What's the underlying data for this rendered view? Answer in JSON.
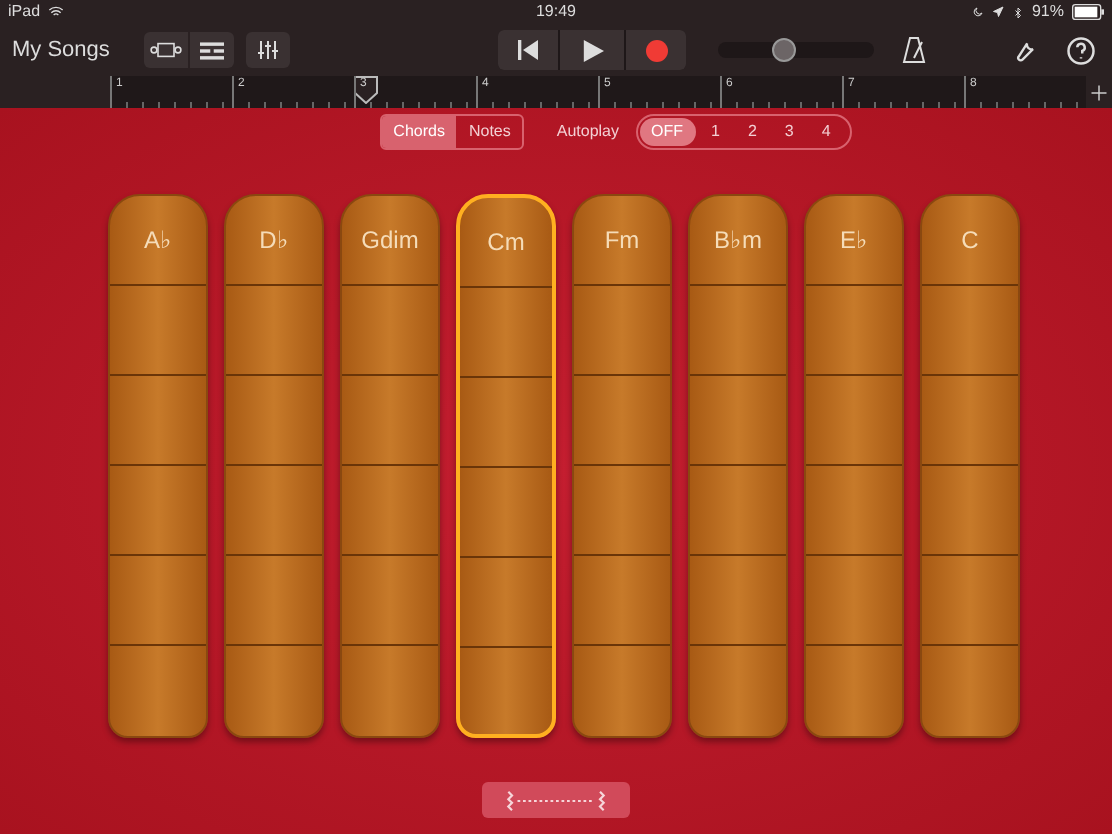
{
  "status_bar": {
    "device": "iPad",
    "time": "19:49",
    "battery": "91%"
  },
  "toolbar": {
    "back_label": "My Songs",
    "volume": {
      "level": 0.42
    }
  },
  "ruler": {
    "bars": [
      {
        "label": "1",
        "playhead": false
      },
      {
        "label": "2",
        "playhead": false
      },
      {
        "label": "3",
        "playhead": true
      },
      {
        "label": "4",
        "playhead": false
      },
      {
        "label": "5",
        "playhead": false
      },
      {
        "label": "6",
        "playhead": false
      },
      {
        "label": "7",
        "playhead": false
      },
      {
        "label": "8",
        "playhead": false
      }
    ]
  },
  "mode_toggle": [
    {
      "label": "Chords",
      "selected": true
    },
    {
      "label": "Notes",
      "selected": false
    }
  ],
  "autoplay": {
    "label": "Autoplay",
    "options": [
      {
        "label": "OFF",
        "selected": true
      },
      {
        "label": "1",
        "selected": false
      },
      {
        "label": "2",
        "selected": false
      },
      {
        "label": "3",
        "selected": false
      },
      {
        "label": "4",
        "selected": false
      }
    ]
  },
  "chords": [
    {
      "label": "A♭",
      "selected": false
    },
    {
      "label": "D♭",
      "selected": false
    },
    {
      "label": "Gdim",
      "selected": false
    },
    {
      "label": "Cm",
      "selected": true
    },
    {
      "label": "Fm",
      "selected": false
    },
    {
      "label": "B♭m",
      "selected": false
    },
    {
      "label": "E♭",
      "selected": false
    },
    {
      "label": "C",
      "selected": false
    }
  ]
}
